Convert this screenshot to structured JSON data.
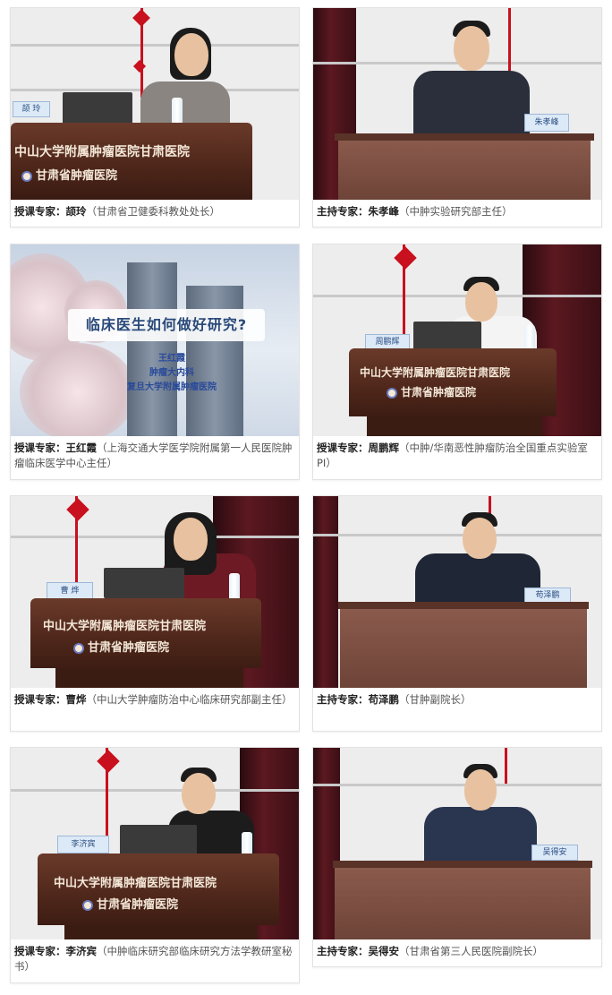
{
  "cards": [
    {
      "role": "授课专家：",
      "name": "颉玲",
      "title": "（甘肃省卫健委科教处处长）",
      "podium_line1": "中山大学附属肿瘤医院甘肃医院",
      "podium_line2": "甘肃省肿瘤医院",
      "nameplate": "颉 玲"
    },
    {
      "role": "主持专家：",
      "name": "朱孝峰",
      "title": "（中肿实验研究部主任）",
      "nameplate": "朱孝峰"
    },
    {
      "role": "授课专家：",
      "name": "王红霞",
      "title": "（上海交通大学医学院附属第一人民医院肿瘤临床医学中心主任）",
      "slide_title": "临床医生如何做好研究?",
      "slide_name": "王红霞",
      "slide_dept": "肿瘤大内科",
      "slide_org": "复旦大学附属肿瘤医院"
    },
    {
      "role": "授课专家：",
      "name": "周鹏辉",
      "title": "（中肿/华南恶性肿瘤防治全国重点实验室PI）",
      "podium_line1": "中山大学附属肿瘤医院甘肃医院",
      "podium_line2": "甘肃省肿瘤医院",
      "nameplate": "周鹏辉"
    },
    {
      "role": "授课专家：",
      "name": "曹烨",
      "title": "（中山大学肿瘤防治中心临床研究部副主任）",
      "podium_line1": "中山大学附属肿瘤医院甘肃医院",
      "podium_line2": "甘肃省肿瘤医院",
      "nameplate": "曹 烨"
    },
    {
      "role": "主持专家：",
      "name": "苟泽鹏",
      "title": "（甘肿副院长）",
      "nameplate": "苟泽鹏"
    },
    {
      "role": "授课专家：",
      "name": "李济宾",
      "title": "（中肿临床研究部临床研究方法学教研室秘书）",
      "podium_line1": "中山大学附属肿瘤医院甘肃医院",
      "podium_line2": "甘肃省肿瘤医院",
      "nameplate": "李济宾"
    },
    {
      "role": "主持专家：",
      "name": "吴得安",
      "title": "（甘肃省第三人民医院副院长）",
      "nameplate": "吴得安"
    }
  ],
  "colors": {
    "podium": "#4a2418",
    "curtain": "#5c1820",
    "knot": "#c8101e",
    "text": "#333333"
  }
}
